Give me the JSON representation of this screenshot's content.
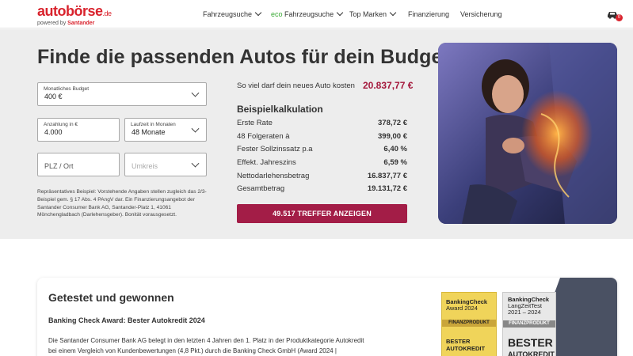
{
  "header": {
    "logo_main": "autobörse",
    "logo_tld": ".de",
    "logo_powered": "powered by",
    "logo_brand": "Santander",
    "nav": [
      {
        "label": "Fahrzeugsuche",
        "has_dropdown": true
      },
      {
        "eco": "eco",
        "label": "Fahrzeugsuche",
        "has_dropdown": true
      },
      {
        "label": "Top Marken",
        "has_dropdown": true
      },
      {
        "label": "Finanzierung",
        "has_dropdown": false
      },
      {
        "label": "Versicherung",
        "has_dropdown": false
      }
    ],
    "parking_count": "0"
  },
  "hero": {
    "title": "Finde die passenden Autos für dein Budget",
    "form": {
      "budget": {
        "label": "Monatliches Budget",
        "value": "400 €"
      },
      "down_payment": {
        "label": "Anzahlung in €",
        "value": "4.000"
      },
      "duration": {
        "label": "Laufzeit in Monaten",
        "value": "48 Monate"
      },
      "location": {
        "placeholder": "PLZ / Ort"
      },
      "radius": {
        "placeholder": "Umkreis"
      }
    },
    "disclaimer": "Repräsentatives Beispiel: Vorstehende Angaben stellen zugleich das 2/3-Beispiel gem. § 17 Abs. 4 PAngV dar. Ein Finanzierungsangebot der Santander Consumer Bank AG, Santander-Platz 1, 41061 Mönchengladbach (Darlehensgeber). Bonität vorausgesetzt.",
    "budget_label": "So viel darf dein neues Auto kosten",
    "budget_value": "20.837,77 €",
    "calc_title": "Beispielkalkulation",
    "calc_rows": [
      {
        "label": "Erste Rate",
        "value": "378,72 €"
      },
      {
        "label": "48 Folgeraten à",
        "value": "399,00 €"
      },
      {
        "label": "Fester Sollzinssatz p.a",
        "value": "6,40 %"
      },
      {
        "label": "Effekt. Jahreszins",
        "value": "6,59 %"
      },
      {
        "label": "Nettodarlehensbetrag",
        "value": "16.837,77 €"
      },
      {
        "label": "Gesamtbetrag",
        "value": "19.131,72 €"
      }
    ],
    "cta": "49.517 TREFFER ANZEIGEN"
  },
  "awards": {
    "title": "Getestet und gewonnen",
    "subtitle": "Banking Check Award: Bester Autokredit 2024",
    "text": "Die Santander Consumer Bank AG belegt in den letzten 4 Jahren den 1. Platz in der Produktkategorie Autokredit bei einem Vergleich von Kundenbewertungen (4,8 Pkt.) durch die Banking Check GmbH (Award 2024 |",
    "badge1": {
      "brand": "BankingCheck",
      "line2": "Award 2024",
      "band": "FINANZPRODUKT",
      "big1": "BESTER",
      "big2": "AUTOKREDIT"
    },
    "badge2": {
      "brand": "BankingCheck",
      "line2": "LangZeitTest",
      "line3": "2021 – 2024",
      "band": "FINANZPRODUKT",
      "big1": "BESTER",
      "big2": "AUTOKREDIT"
    }
  },
  "colors": {
    "brand_red": "#d9232d",
    "cta": "#a31d47",
    "eco_green": "#3aaa35",
    "hero_bg": "#ededed"
  }
}
